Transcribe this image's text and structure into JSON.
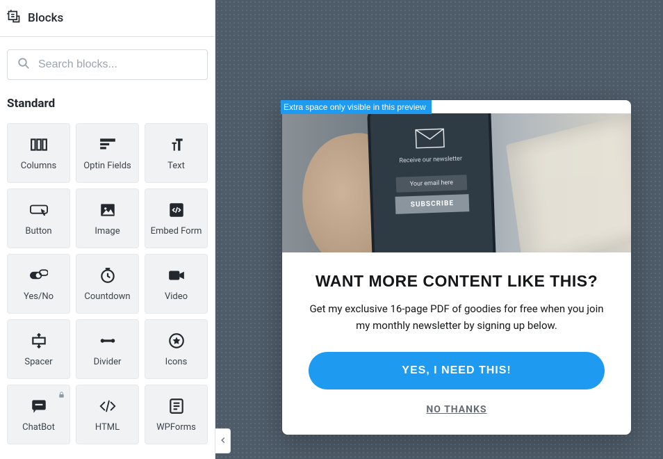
{
  "sidebar": {
    "title": "Blocks",
    "search_placeholder": "Search blocks...",
    "section_label": "Standard",
    "blocks": [
      {
        "label": "Columns",
        "icon": "columns"
      },
      {
        "label": "Optin Fields",
        "icon": "optin"
      },
      {
        "label": "Text",
        "icon": "text"
      },
      {
        "label": "Button",
        "icon": "button"
      },
      {
        "label": "Image",
        "icon": "image"
      },
      {
        "label": "Embed Form",
        "icon": "embed"
      },
      {
        "label": "Yes/No",
        "icon": "yesno"
      },
      {
        "label": "Countdown",
        "icon": "countdown"
      },
      {
        "label": "Video",
        "icon": "video"
      },
      {
        "label": "Spacer",
        "icon": "spacer"
      },
      {
        "label": "Divider",
        "icon": "divider"
      },
      {
        "label": "Icons",
        "icon": "icons"
      },
      {
        "label": "ChatBot",
        "icon": "chatbot",
        "locked": true
      },
      {
        "label": "HTML",
        "icon": "html"
      },
      {
        "label": "WPForms",
        "icon": "wpforms"
      }
    ]
  },
  "preview": {
    "notice": "Extra space only visible in this preview",
    "phone": {
      "newsletter_label": "Receive our newsletter",
      "email_placeholder": "Your email here",
      "subscribe_label": "SUBSCRIBE"
    },
    "popup": {
      "title": "WANT MORE CONTENT LIKE THIS?",
      "description": "Get my exclusive 16-page PDF of goodies for free when you join my monthly newsletter by signing up below.",
      "cta_label": "YES, I NEED THIS!",
      "decline_label": "NO THANKS"
    }
  },
  "colors": {
    "accent": "#1e9bf0",
    "canvas": "#4e5c69"
  }
}
